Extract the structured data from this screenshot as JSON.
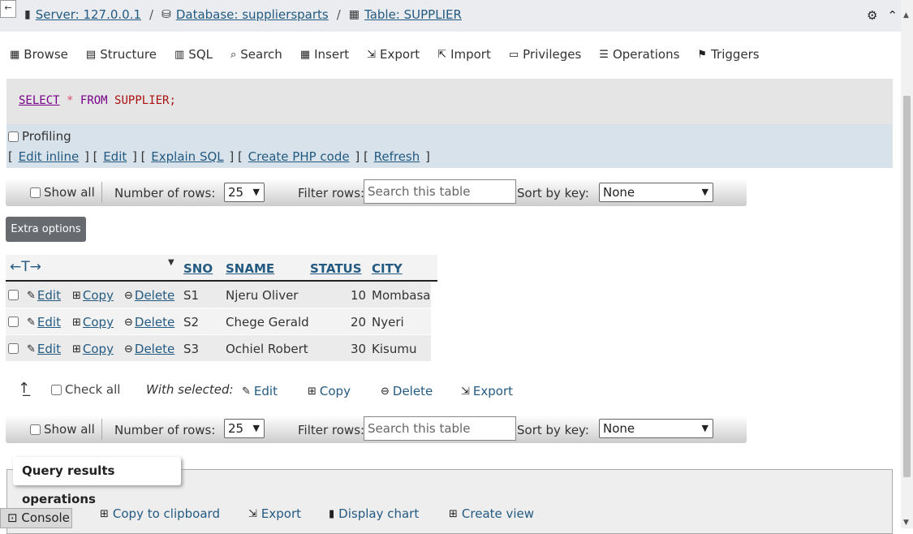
{
  "breadcrumb": {
    "back_label": "←",
    "server": "Server: 127.0.0.1",
    "database": "Database: suppliersparts",
    "table": "Table: SUPPLIER",
    "sep": "/"
  },
  "topright": {
    "settings_icon": "⚙",
    "collapse_icon": "⌃"
  },
  "tabs": [
    {
      "label": "Browse",
      "icon": "▦"
    },
    {
      "label": "Structure",
      "icon": "▤"
    },
    {
      "label": "SQL",
      "icon": "▥"
    },
    {
      "label": "Search",
      "icon": "🔍"
    },
    {
      "label": "Insert",
      "icon": "▦"
    },
    {
      "label": "Export",
      "icon": "⇲"
    },
    {
      "label": "Import",
      "icon": "⇱"
    },
    {
      "label": "Privileges",
      "icon": "▭"
    },
    {
      "label": "Operations",
      "icon": "☰"
    },
    {
      "label": "Triggers",
      "icon": "⚑"
    }
  ],
  "sql": {
    "select": "SELECT",
    "star": "*",
    "from": "FROM",
    "table": "SUPPLIER;"
  },
  "profiling_label": "Profiling",
  "sql_links": [
    "Edit inline",
    "Edit",
    "Explain SQL",
    "Create PHP code",
    "Refresh"
  ],
  "nav": {
    "show_all": "Show all",
    "number_of_rows_label": "Number of rows:",
    "number_of_rows_value": "25",
    "filter_label": "Filter rows:",
    "filter_placeholder": "Search this table",
    "sort_label": "Sort by key:",
    "sort_value": "None"
  },
  "extra_options": "Extra options",
  "table": {
    "columns": [
      "SNO",
      "SNAME",
      "STATUS",
      "CITY"
    ],
    "arrows": "←T→",
    "rows": [
      {
        "sno": "S1",
        "sname": "Njeru Oliver",
        "status": "10",
        "city": "Mombasa"
      },
      {
        "sno": "S2",
        "sname": "Chege Gerald",
        "status": "20",
        "city": "Nyeri"
      },
      {
        "sno": "S3",
        "sname": "Ochiel Robert",
        "status": "30",
        "city": "Kisumu"
      }
    ],
    "row_actions": {
      "edit": "Edit",
      "copy": "Copy",
      "delete": "Delete"
    }
  },
  "bulk": {
    "check_all": "Check all",
    "with_selected": "With selected:",
    "edit": "Edit",
    "copy": "Copy",
    "delete": "Delete",
    "export": "Export"
  },
  "query_ops": {
    "title": "Query results operations",
    "copy_clipboard": "Copy to clipboard",
    "export": "Export",
    "display_chart": "Display chart",
    "create_view": "Create view"
  },
  "console_label": "Console"
}
